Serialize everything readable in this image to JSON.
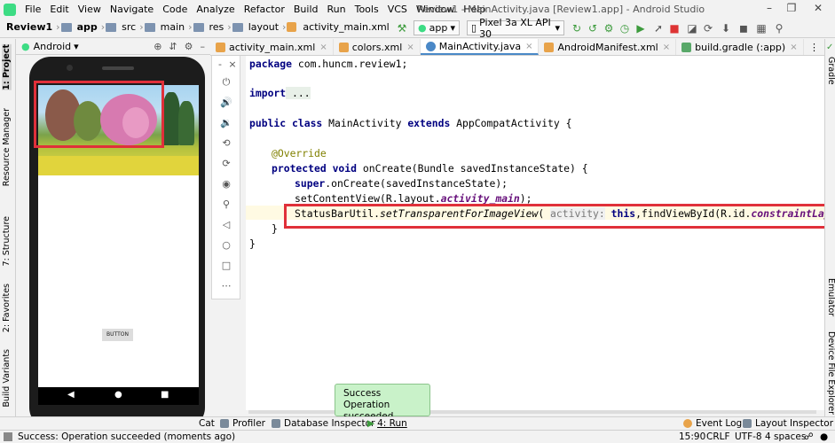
{
  "window": {
    "title": "Review1 - MainActivity.java [Review1.app] - Android Studio",
    "menu": [
      "File",
      "Edit",
      "View",
      "Navigate",
      "Code",
      "Analyze",
      "Refactor",
      "Build",
      "Run",
      "Tools",
      "VCS",
      "Window",
      "Help"
    ]
  },
  "breadcrumb": [
    "Review1",
    "app",
    "src",
    "main",
    "res",
    "layout",
    "activity_main.xml"
  ],
  "toolbar": {
    "run_config": "app",
    "device": "Pixel 3a XL API 30"
  },
  "project_panel": {
    "view_label": "Android"
  },
  "tabs": [
    {
      "label": "activity_main.xml",
      "color": "#e8a34a"
    },
    {
      "label": "colors.xml",
      "color": "#e8a34a"
    },
    {
      "label": "MainActivity.java",
      "color": "#4a88c7",
      "active": true
    },
    {
      "label": "AndroidManifest.xml",
      "color": "#e8a34a"
    },
    {
      "label": "build.gradle (:app)",
      "color": "#59a869"
    }
  ],
  "code": {
    "l1_kw": "package",
    "l1_rest": " com.huncm.review1;",
    "l2_kw": "import",
    "l2_rest": " ...",
    "l3_kw1": "public class",
    "l3_mid": " MainActivity ",
    "l3_kw2": "extends",
    "l3_rest": " AppCompatActivity {",
    "l4_ann": "@Override",
    "l5_kw": "protected void",
    "l5_rest": " onCreate(Bundle savedInstanceState) {",
    "l6_kw": "super",
    "l6_rest": ".onCreate(savedInstanceState);",
    "l7_pre": "setContentView(R.layout.",
    "l7_field": "activity_main",
    "l7_post": ");",
    "l8_pre": "StatusBarUtil.",
    "l8_method": "setTransparentForImageView",
    "l8_open": "( ",
    "l8_hint": "activity:",
    "l8_kw": " this",
    "l8_mid": ",findViewById(R.id.",
    "l8_field": "constraintLayout",
    "l8_post": "));",
    "l9": "}",
    "l10": "}"
  },
  "left_tabs": [
    "1: Project",
    "Resource Manager",
    "7: Structure",
    "2: Favorites",
    "Build Variants"
  ],
  "right_tabs": [
    "Gradle",
    "Emulator",
    "Device File Explorer"
  ],
  "phone": {
    "button_label": "BUTTON"
  },
  "toast": {
    "title": "Success",
    "message": "Operation succeeded"
  },
  "bottom_tools": [
    "Cat",
    "Profiler",
    "Database Inspector",
    "4: Run",
    "Event Log",
    "Layout Inspector"
  ],
  "status": {
    "message": "Success: Operation succeeded (moments ago)",
    "position": "15:90",
    "line_sep": "CRLF",
    "encoding": "UTF-8",
    "indent": "4 spaces"
  }
}
